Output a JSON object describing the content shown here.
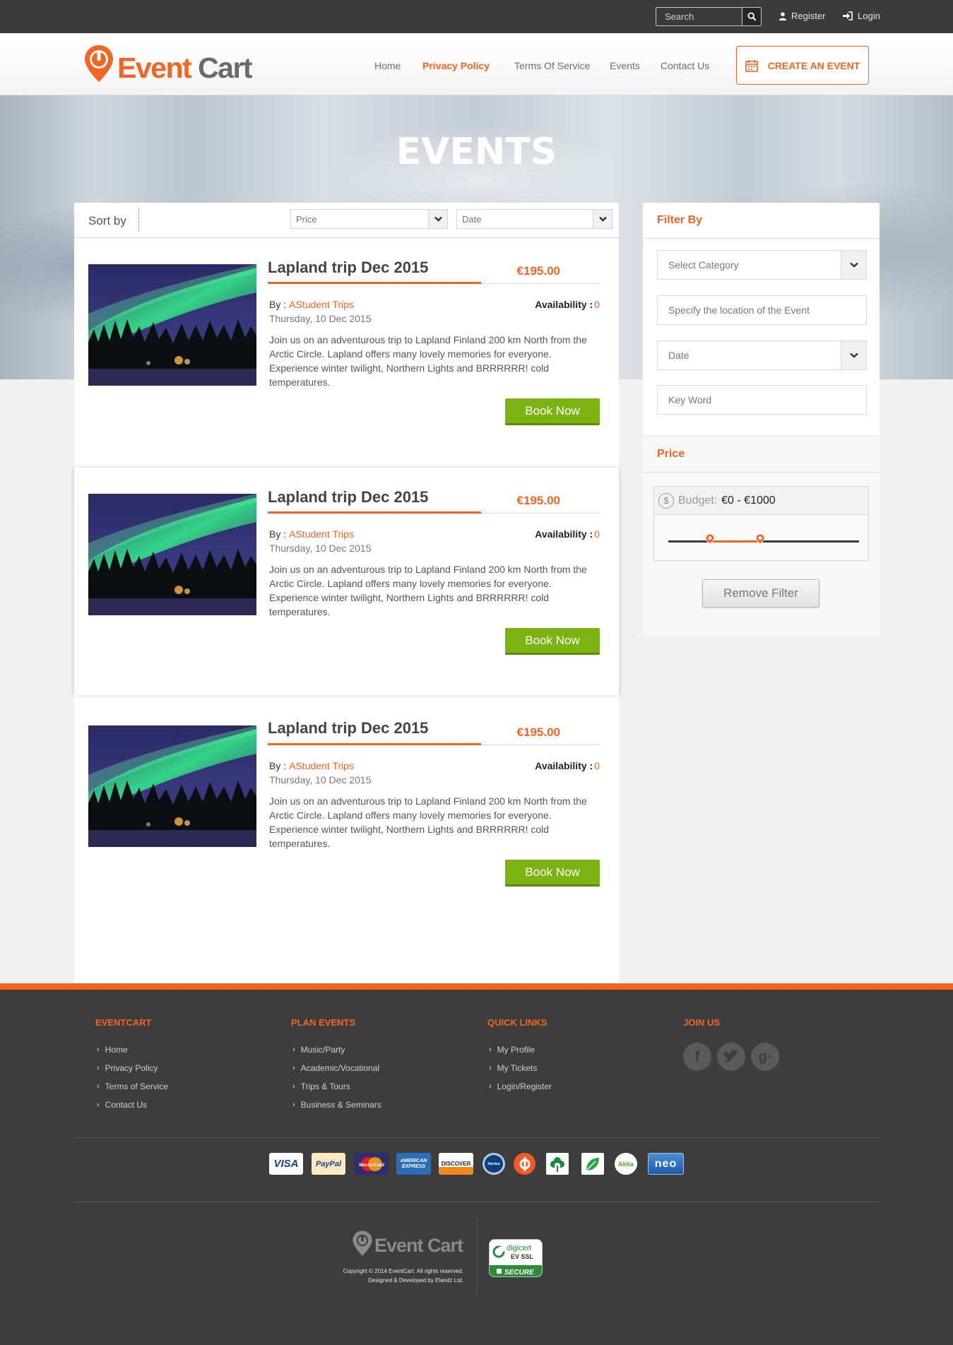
{
  "topbar": {
    "search_placeholder": "Search",
    "register": "Register",
    "login": "Login"
  },
  "header": {
    "logo_event": "Event",
    "logo_cart": "Cart",
    "nav": [
      "Home",
      "Privacy Policy",
      "Terms Of Service",
      "Events",
      "Contact Us"
    ],
    "active_nav": "Privacy Policy",
    "create_event": "CREATE AN EVENT"
  },
  "hero": {
    "title": "EVENTS"
  },
  "sort": {
    "label": "Sort by",
    "price_select": "Price",
    "date_select": "Date"
  },
  "events": [
    {
      "title": "Lapland trip Dec 2015",
      "price": "€195.00",
      "by_label": "By :",
      "organizer": "AStudent Trips",
      "availability_label": "Availability :",
      "availability": "0",
      "date": "Thursday, 10 Dec 2015",
      "description": "Join us on an adventurous trip to Lapland Finland 200 km North from the Arctic Circle. Lapland offers many lovely memories for everyone. Experience winter twilight, Northern Lights and BRRRRRR! cold temperatures.",
      "button": "Book Now"
    },
    {
      "title": "Lapland trip Dec 2015",
      "price": "€195.00",
      "by_label": "By :",
      "organizer": "AStudent Trips",
      "availability_label": "Availability :",
      "availability": "0",
      "date": "Thursday, 10 Dec 2015",
      "description": "Join us on an adventurous trip to Lapland Finland 200 km North from the Arctic Circle. Lapland offers many lovely memories for everyone. Experience winter twilight, Northern Lights and BRRRRRR! cold temperatures.",
      "button": "Book Now"
    },
    {
      "title": "Lapland trip Dec 2015",
      "price": "€195.00",
      "by_label": "By :",
      "organizer": "AStudent Trips",
      "availability_label": "Availability :",
      "availability": "0",
      "date": "Thursday, 10 Dec 2015",
      "description": "Join us on an adventurous trip to Lapland Finland 200 km North from the Arctic Circle. Lapland offers many lovely memories for everyone. Experience winter twilight, Northern Lights and BRRRRRR! cold temperatures.",
      "button": "Book Now"
    }
  ],
  "filter": {
    "title": "Filter By",
    "category_placeholder": "Select Category",
    "location_placeholder": "Specify the location of the Event",
    "date_placeholder": "Date",
    "keyword_placeholder": "Key Word",
    "price_title": "Price",
    "budget_label": "Budget:",
    "budget_value": "€0 - €1000",
    "slider_low_fraction": 0.22,
    "slider_high_fraction": 0.48,
    "remove_button": "Remove Filter"
  },
  "footer": {
    "columns": [
      {
        "title": "EVENTCART",
        "items": [
          "Home",
          "Privacy Policy",
          "Terms of Service",
          "Contact Us"
        ]
      },
      {
        "title": "PLAN EVENTS",
        "items": [
          "Music/Party",
          "Academic/Vocational",
          "Trips & Tours",
          "Business & Seminars"
        ]
      },
      {
        "title": "QUICK LINKS",
        "items": [
          "My Profile",
          "My Tickets",
          "Login/Register"
        ]
      },
      {
        "title": "JOIN US",
        "items": []
      }
    ],
    "social": [
      "facebook-icon",
      "twitter-icon",
      "google-plus-icon"
    ],
    "payments": {
      "visa": "VISA",
      "paypal": "PayPal",
      "mastercard": "MasterCard",
      "amex": "AMERICAN EXPRESS",
      "discover": "DISCOVER",
      "nordea": "Nordea",
      "aktia": "Aktia",
      "neo": "neo"
    },
    "logo_text": "Event Cart",
    "copyright": "Copyright © 2014 EventCart. All rights reserved.",
    "developed": "Designed & Developed by Elandz Ltd.",
    "digicert_brand": "digicert",
    "digicert_type": "EV SSL",
    "digicert_secure": "SECURE"
  },
  "colors": {
    "accent": "#f26522",
    "book_button": "#7cb313",
    "dark_bar": "#3a3a3a",
    "footer_bg": "#3d3d3d"
  }
}
